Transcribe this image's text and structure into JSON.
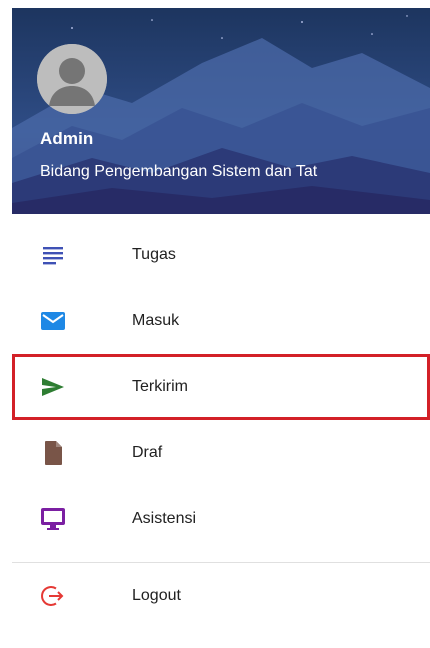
{
  "user": {
    "name": "Admin",
    "department": "Bidang Pengembangan Sistem dan Tat"
  },
  "menu": {
    "items": [
      {
        "id": "tugas",
        "label": "Tugas",
        "icon": "list-lines-icon",
        "color": "#3f51b5",
        "selected": false
      },
      {
        "id": "masuk",
        "label": "Masuk",
        "icon": "envelope-icon",
        "color": "#1e88e5",
        "selected": false
      },
      {
        "id": "terkirim",
        "label": "Terkirim",
        "icon": "send-icon",
        "color": "#2e7d32",
        "selected": true
      },
      {
        "id": "draf",
        "label": "Draf",
        "icon": "file-icon",
        "color": "#795548",
        "selected": false
      },
      {
        "id": "asistensi",
        "label": "Asistensi",
        "icon": "monitor-icon",
        "color": "#7b1fa2",
        "selected": false
      }
    ],
    "logout": {
      "label": "Logout",
      "icon": "logout-icon",
      "color": "#e53935"
    }
  },
  "colors": {
    "selection_outline": "#d32027",
    "header_bg": "#2c3f74"
  }
}
